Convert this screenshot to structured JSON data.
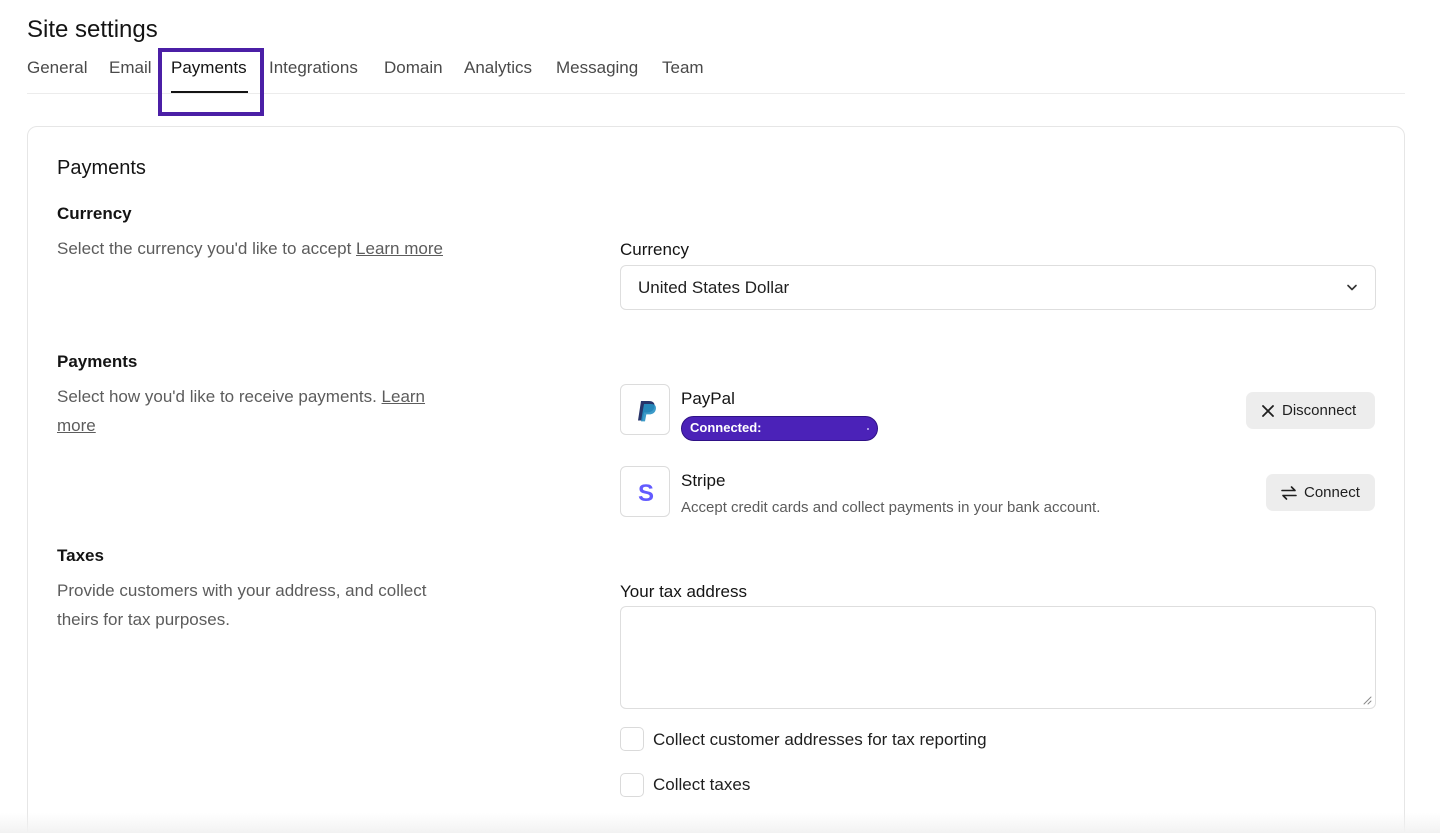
{
  "page": {
    "title": "Site settings"
  },
  "tabs": [
    {
      "label": "General"
    },
    {
      "label": "Email"
    },
    {
      "label": "Payments",
      "active": true
    },
    {
      "label": "Integrations"
    },
    {
      "label": "Domain"
    },
    {
      "label": "Analytics"
    },
    {
      "label": "Messaging"
    },
    {
      "label": "Team"
    }
  ],
  "card": {
    "title": "Payments",
    "currency": {
      "heading": "Currency",
      "description": "Select the currency you'd like to accept",
      "link": "Learn more",
      "field_label": "Currency",
      "selected": "United States Dollar",
      "icon": "chevron-down-icon"
    },
    "payments": {
      "heading": "Payments",
      "description": "Select how you'd like to receive payments.",
      "link_line1": "Learn",
      "link_line2": "more",
      "paypal": {
        "name": "PayPal",
        "status": "Connected:",
        "action": "Disconnect",
        "icon": "paypal-logo-icon",
        "action_icon": "close-icon",
        "badge_color": "#4b22b8"
      },
      "stripe": {
        "name": "Stripe",
        "description": "Accept credit cards and collect payments in your bank account.",
        "action": "Connect",
        "logo_letter": "S",
        "icon": "stripe-logo-icon",
        "action_icon": "swap-arrows-icon",
        "brand_color": "#635bff"
      }
    },
    "taxes": {
      "heading": "Taxes",
      "description_line1": "Provide customers with your address, and collect",
      "description_line2": "theirs for tax purposes.",
      "field_label": "Your tax address",
      "address_value": "",
      "checkbox_addresses": {
        "label": "Collect customer addresses for tax reporting",
        "checked": false
      },
      "checkbox_taxes": {
        "label": "Collect taxes",
        "checked": false
      }
    }
  },
  "colors": {
    "highlight": "#4b1fa6",
    "text": "#141414",
    "muted": "#5c5c5c",
    "button_bg": "#ededed"
  }
}
